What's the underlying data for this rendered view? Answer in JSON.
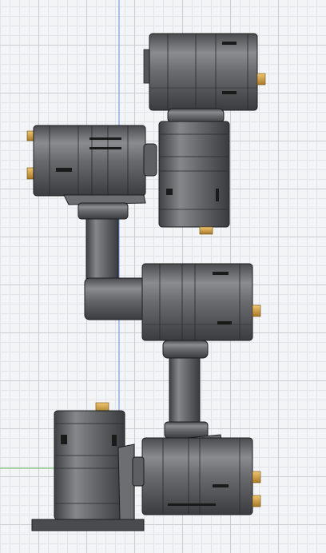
{
  "viewport": {
    "background": "#f3f4f5",
    "grid_major": "#c9ced3",
    "grid_minor": "#e2e5e8",
    "axis_y_color": "#7a9fe0",
    "axis_x_color": "#78c078"
  },
  "model": {
    "body_color": "#5e5f63",
    "body_dark": "#3f4044",
    "body_light": "#8a8b8f",
    "connector_color": "#d6a64a"
  }
}
